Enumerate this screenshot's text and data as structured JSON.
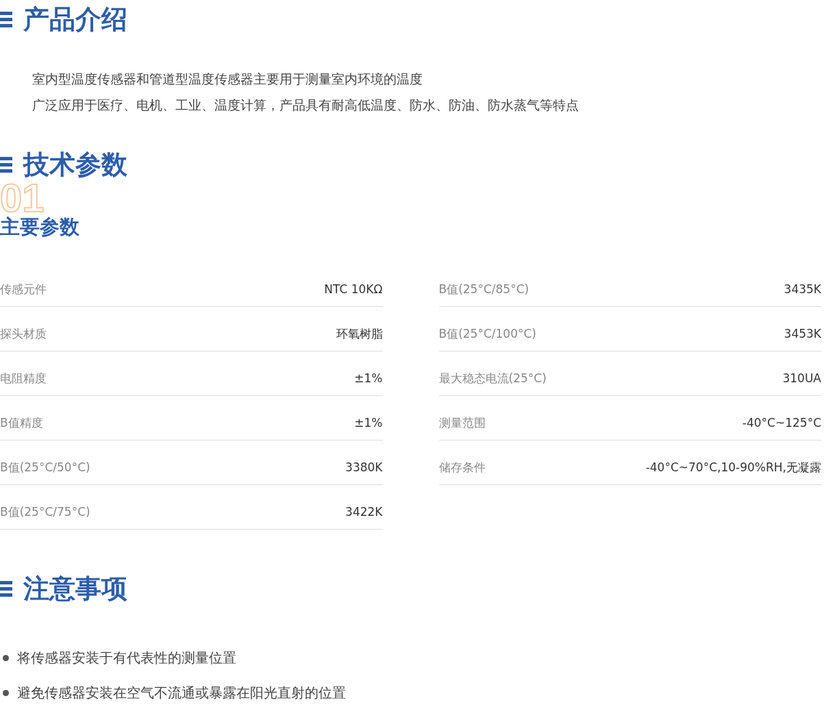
{
  "intro": {
    "title": "产品介绍",
    "lines": [
      "室内型温度传感器和管道型温度传感器主要用于测量室内环境的温度",
      "广泛应用于医疗、电机、工业、温度计算，产品具有耐高低温度、防水、防油、防水蒸气等特点"
    ]
  },
  "specs": {
    "title": "技术参数",
    "number": "01",
    "subtitle": "主要参数",
    "left": [
      {
        "label": "传感元件",
        "value": "NTC 10KΩ"
      },
      {
        "label": "探头材质",
        "value": "环氧树脂"
      },
      {
        "label": "电阻精度",
        "value": "±1%"
      },
      {
        "label": "B值精度",
        "value": "±1%"
      },
      {
        "label": "B值(25°C/50°C)",
        "value": "3380K"
      },
      {
        "label": "B值(25°C/75°C)",
        "value": "3422K"
      }
    ],
    "right": [
      {
        "label": "B值(25°C/85°C)",
        "value": "3435K"
      },
      {
        "label": "B值(25°C/100°C)",
        "value": "3453K"
      },
      {
        "label": "最大稳态电流(25°C)",
        "value": "310UA"
      },
      {
        "label": "测量范围",
        "value": "-40°C~125°C"
      },
      {
        "label": "储存条件",
        "value": "-40°C~70°C,10-90%RH,无凝露"
      }
    ]
  },
  "notes": {
    "title": "注意事项",
    "items": [
      "将传感器安装于有代表性的测量位置",
      "避免传感器安装在空气不流通或暴露在阳光直射的位置"
    ]
  }
}
